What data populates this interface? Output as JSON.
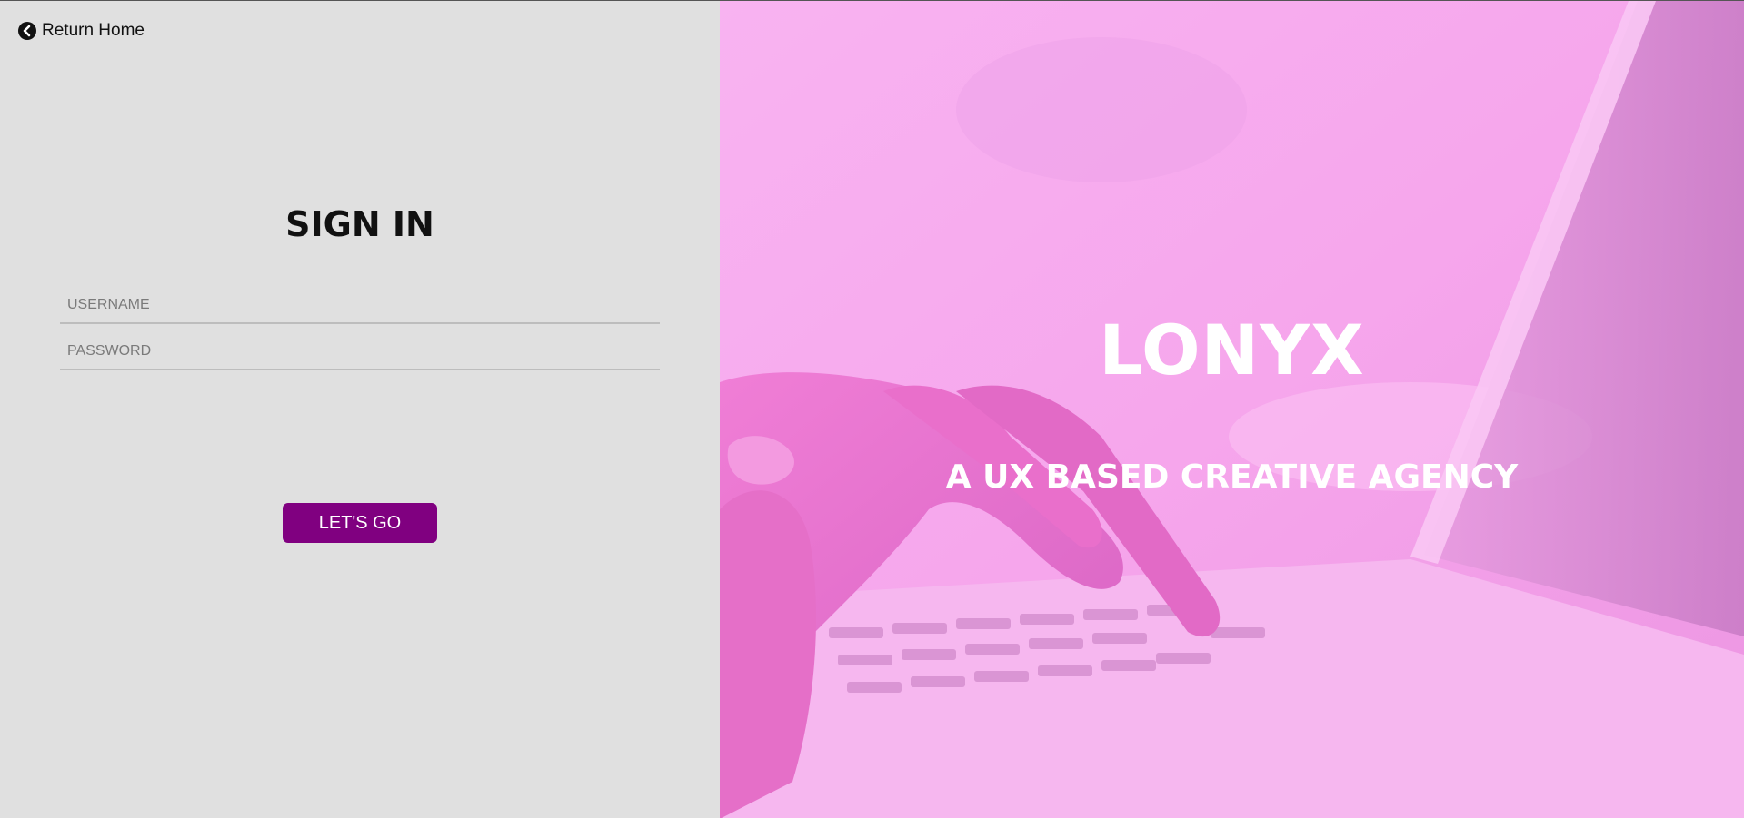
{
  "nav": {
    "return_home_label": "Return Home",
    "return_icon": "chevron-left-circle-icon"
  },
  "login": {
    "title": "SIGN IN",
    "username_placeholder": "USERNAME",
    "password_placeholder": "PASSWORD",
    "submit_label": "LET'S GO"
  },
  "hero": {
    "brand": "LONYX",
    "tagline": "A UX BASED CREATIVE AGENCY",
    "image": "hands-typing-on-laptop"
  },
  "colors": {
    "left_bg": "#e0e0e0",
    "accent": "#800080",
    "hero_tint": "#f7a9ee",
    "hero_text": "#ffffff"
  }
}
